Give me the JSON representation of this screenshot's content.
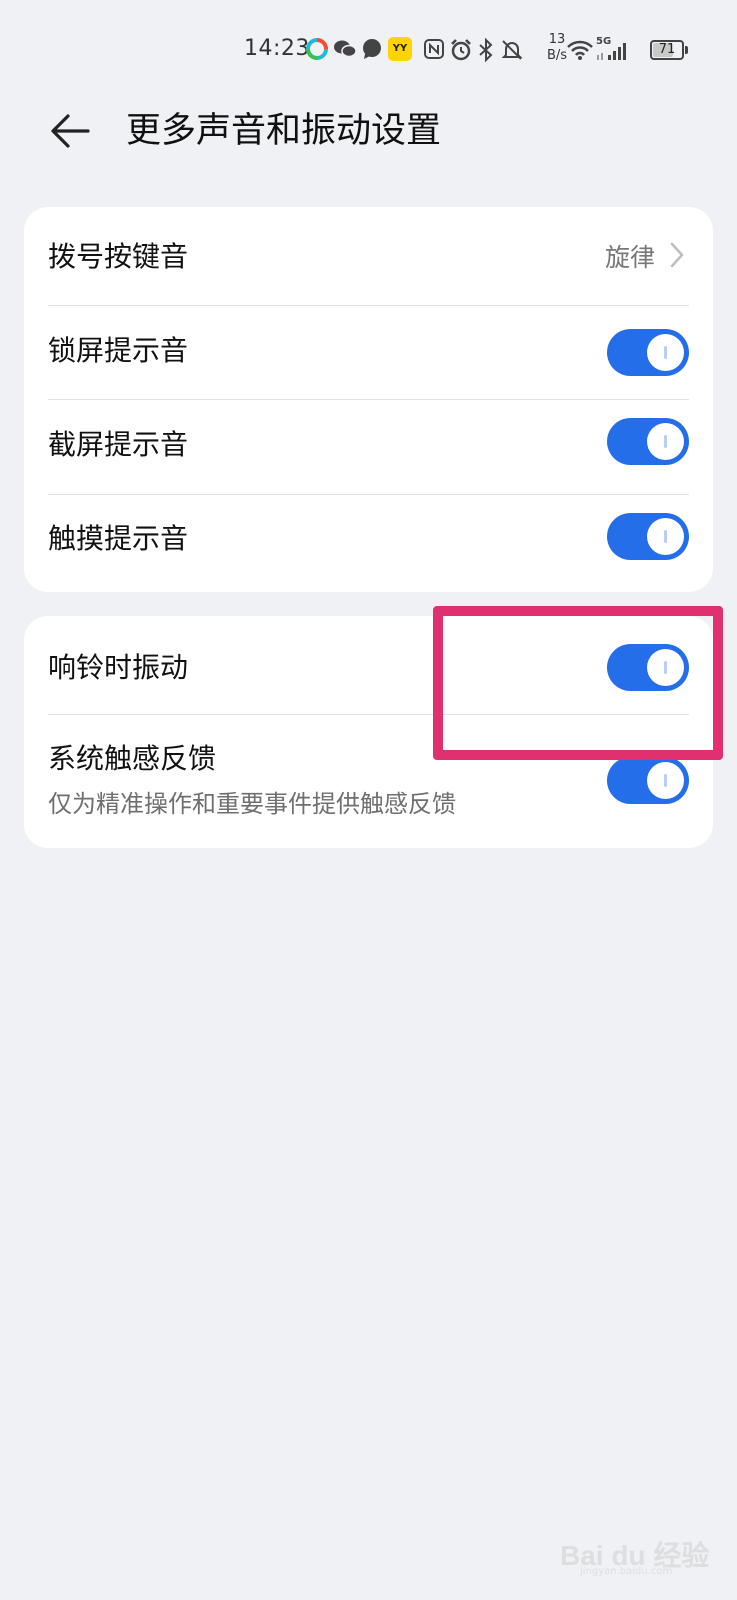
{
  "status_bar": {
    "time": "14:23",
    "net_speed_value": "13",
    "net_speed_unit": "B/s",
    "network_type": "5G",
    "battery_level": "71",
    "battery_percent": 71,
    "icons": [
      "app-icon",
      "wechat-icon",
      "message-icon",
      "yy-app-icon",
      "nfc-icon",
      "alarm-icon",
      "bluetooth-icon",
      "mute-icon",
      "wifi-icon",
      "signal-icon",
      "battery-icon"
    ]
  },
  "header": {
    "title": "更多声音和振动设置",
    "back_icon": "arrow-left-icon"
  },
  "group1": {
    "rows": [
      {
        "label": "拨号按键音",
        "value": "旋律",
        "type": "link"
      },
      {
        "label": "锁屏提示音",
        "type": "toggle",
        "on": true
      },
      {
        "label": "截屏提示音",
        "type": "toggle",
        "on": true
      },
      {
        "label": "触摸提示音",
        "type": "toggle",
        "on": true
      }
    ]
  },
  "group2": {
    "rows": [
      {
        "label": "响铃时振动",
        "type": "toggle",
        "on": true
      },
      {
        "label": "系统触感反馈",
        "subtitle": "仅为精准操作和重要事件提供触感反馈",
        "type": "toggle",
        "on": true
      }
    ]
  },
  "watermark": {
    "brand": "Bai du 经验",
    "url": "jingyan.baidu.com"
  },
  "colors": {
    "accent": "#246ee9",
    "highlight": "#e0306f",
    "background": "#f0f1f5"
  }
}
